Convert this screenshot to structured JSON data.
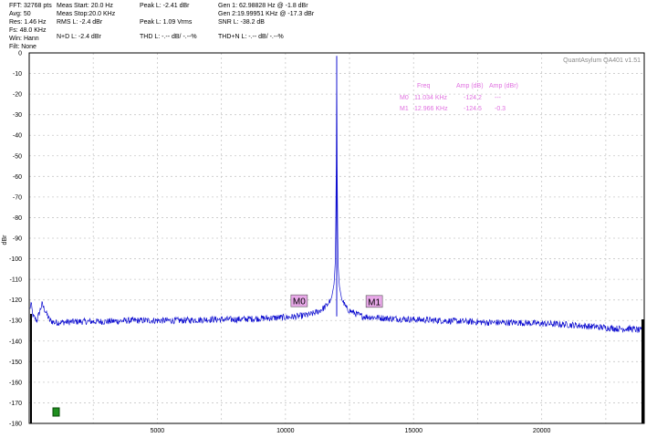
{
  "header": {
    "col1": [
      "FFT: 32768 pts",
      "Avg: 50",
      "Res: 1.46 Hz",
      "Fs: 48.0 KHz",
      "Win: Hann",
      "Filt: None"
    ],
    "col2": [
      "Meas Start: 20.0 Hz",
      "Meas Stop:20.0 KHz",
      "RMS L: -2.4 dBr"
    ],
    "col3": [
      "Peak L: -2.41 dBr",
      "",
      "Peak L: 1.09 Vrms"
    ],
    "col4": [
      "Gen 1: 62.98828 Hz @ -1.8  dBr",
      "Gen 2:19.99951 KHz @ -17.3  dBr",
      "SNR L: -38.2 dB"
    ],
    "nd": "N+D L: -2.4 dBr",
    "thd": "THD L: -.-- dB/ -.--%",
    "thdn": "THD+N L: -.-- dB/ -.--%"
  },
  "watermark": "QuantAsylum QA401 v1.51",
  "marker_table": {
    "headers": [
      "Freq",
      "Amp (dB)",
      "Amp (dBr)"
    ],
    "rows": [
      {
        "label": "M0",
        "freq": "11.034 KHz",
        "amp_db": "-124.2",
        "amp_dbr": "---"
      },
      {
        "label": "M1",
        "freq": "12.966 KHz",
        "amp_db": "-124.5",
        "amp_dbr": "-0.3"
      }
    ]
  },
  "markers": [
    {
      "label": "M0",
      "freq": 11034,
      "amp": -124.2
    },
    {
      "label": "M1",
      "freq": 12966,
      "amp": -124.5
    }
  ],
  "colors": {
    "trace": "#1010d0",
    "marker_fill": "#e8a8e8",
    "marker_text": "#e070e0",
    "grid": "#c8c8c8"
  },
  "chart_data": {
    "type": "line",
    "title": "",
    "xlabel": "",
    "ylabel": "dBr",
    "xlim": [
      0,
      24000
    ],
    "ylim": [
      -180,
      0
    ],
    "xticks": [
      5000,
      10000,
      15000,
      20000
    ],
    "yticks": [
      0,
      -10,
      -20,
      -30,
      -40,
      -50,
      -60,
      -70,
      -80,
      -90,
      -100,
      -110,
      -120,
      -130,
      -140,
      -150,
      -160,
      -170,
      -180
    ],
    "grid": true,
    "series": [
      {
        "x": [
          20,
          63,
          150,
          300,
          500,
          800,
          1000,
          2000,
          3000,
          4000,
          5000,
          6000,
          7000,
          8000,
          9000,
          10000,
          10500,
          11000,
          11300,
          11600,
          11800,
          11900,
          11950,
          11980,
          12000,
          12020,
          12050,
          12100,
          12200,
          12400,
          12700,
          13000,
          14000,
          15000,
          16000,
          17000,
          18000,
          19000,
          20000,
          21000,
          22000,
          23000,
          23500,
          23900
        ],
        "y": [
          -127,
          -121,
          -128,
          -130,
          -122,
          -130,
          -131,
          -130.5,
          -130.5,
          -130,
          -130,
          -130,
          -129.5,
          -129.5,
          -129,
          -128.5,
          -128,
          -127,
          -125.5,
          -123,
          -119,
          -112,
          -100,
          -60,
          -1.5,
          -62,
          -102,
          -113,
          -120,
          -124.5,
          -126.5,
          -128,
          -129,
          -129.5,
          -130,
          -130.5,
          -131,
          -131,
          -131.5,
          -132,
          -133,
          -134,
          -134,
          -135
        ]
      }
    ]
  }
}
